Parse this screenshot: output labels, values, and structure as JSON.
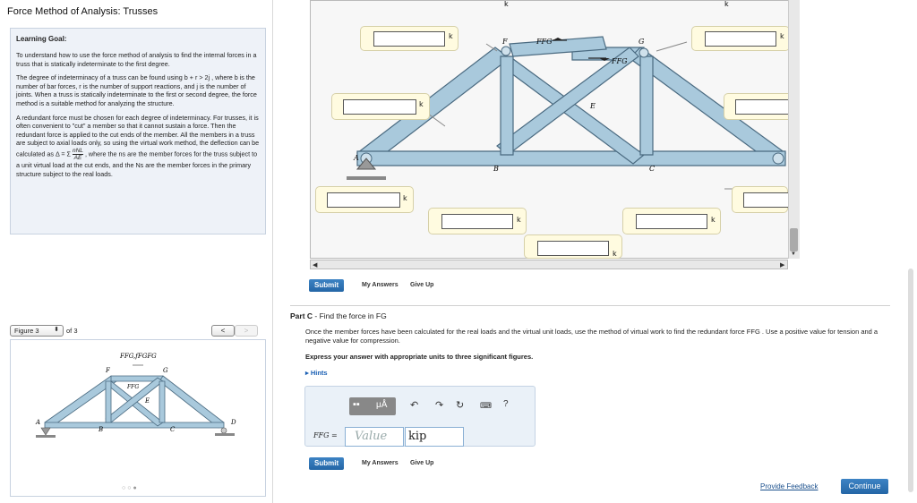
{
  "app": {
    "title": "Force Method of Analysis: Trusses"
  },
  "learning_goal": {
    "heading": "Learning Goal:",
    "p1": "To understand how to use the force method of analysis to find the internal forces in a truss that is statically indeterminate to the first degree.",
    "p2": "The degree of indeterminacy of a truss can be found using b + r > 2j , where b is the number of bar forces, r is the number of support reactions, and j is the number of joints. When a truss is statically indeterminate to the first or second degree, the force method is a suitable method for analyzing the structure.",
    "p3a": "A redundant force must be chosen for each degree of indeterminacy. For trusses, it is often convenient to \"cut\" a member so that it cannot sustain a force. Then the redundant force is applied to the cut ends of the member. All the members in a truss are subject to axial loads only, so using the virtual work method, the deflection can be calculated as Δ = Σ",
    "frac_num": "nNL",
    "frac_den": "AE",
    "p3b": ", where the ns are the member forces for the truss subject to a unit virtual load at the cut ends, and the Ns are the member forces in the primary structure subject to the real loads."
  },
  "figure_nav": {
    "select": "Figure 3",
    "count": "of 3",
    "prev": "<",
    "next": ">",
    "dots": "○○●"
  },
  "small_figure": {
    "label_top": "FFG,fFGFG",
    "F": "F",
    "G": "G",
    "A": "A",
    "B": "B",
    "C": "C",
    "D": "D",
    "E": "E",
    "FFG": "FFG"
  },
  "diagram": {
    "nodes": {
      "F": "F",
      "G": "G",
      "A": "A",
      "B": "B",
      "C": "C",
      "E": "E"
    },
    "force_label_1": "FFG",
    "force_label_2": "FFG",
    "top_k_1": "k",
    "top_k_2": "k",
    "unit": "k"
  },
  "part_b": {
    "submit": "Submit",
    "my_answers": "My Answers",
    "give_up": "Give Up"
  },
  "part_c": {
    "label": "Part C",
    "title_rest": " - Find the force in FG",
    "description": "Once the member forces have been calculated for the real loads and the virtual unit loads, use the method of virtual work to find the redundant force FFG . Use a positive value for tension and a negative value for compression.",
    "instruction": "Express your answer with appropriate units to three significant figures.",
    "hints": "▸ Hints",
    "var_label": "FFG =",
    "value_placeholder": "Value",
    "unit_value": "kip",
    "submit": "Submit",
    "my_answers": "My Answers",
    "give_up": "Give Up"
  },
  "footer": {
    "feedback": "Provide Feedback",
    "continue": "Continue"
  },
  "colors": {
    "truss_fill": "#a9c9dc",
    "truss_stroke": "#4a6a80",
    "answer_box": "#fffbe0",
    "submit_blue": "#2466a6"
  }
}
